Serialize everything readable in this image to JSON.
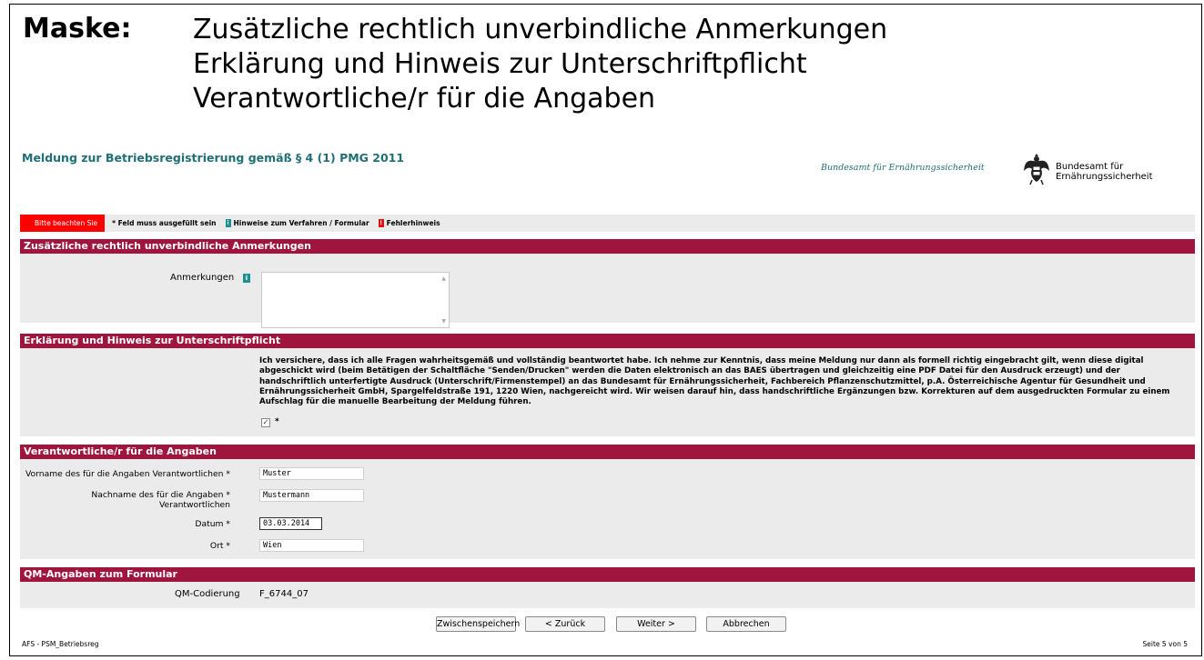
{
  "header": {
    "maske_label": "Maske:",
    "maske_lines": [
      "Zusätzliche rechtlich unverbindliche Anmerkungen",
      "Erklärung und Hinweis zur Unterschriftpflicht",
      "Verantwortliche/r für die Angaben"
    ]
  },
  "app": {
    "title": "Meldung zur Betriebsregistrierung gemäß § 4 (1) PMG 2011",
    "agency_script": "Bundesamt für Ernährungssicherheit",
    "agency_name": "Bundesamt für Ernährungssicherheit"
  },
  "legend": {
    "warning": "Bitte beachten Sie",
    "required": "* Feld muss ausgefüllt sein",
    "info": "Hinweise zum Verfahren / Formular",
    "error": "Fehlerhinweis",
    "info_icon_char": "i",
    "error_icon_char": "!"
  },
  "sections": {
    "anmerkungen": {
      "title": "Zusätzliche rechtlich unverbindliche Anmerkungen",
      "label": "Anmerkungen",
      "value": ""
    },
    "erklaerung": {
      "title": "Erklärung und Hinweis zur Unterschriftpflicht",
      "text": "Ich versichere, dass ich alle Fragen wahrheitsgemäß und vollständig beantwortet habe. Ich nehme zur Kenntnis, dass meine Meldung nur dann als formell richtig eingebracht gilt, wenn diese digital abgeschickt wird (beim Betätigen der Schaltfläche \"Senden/Drucken\" werden die Daten elektronisch an das BAES übertragen und gleichzeitig eine PDF Datei für den Ausdruck erzeugt) und der handschriftlich unterfertigte Ausdruck (Unterschrift/Firmenstempel) an das Bundesamt für Ernährungssicherheit, Fachbereich Pflanzenschutzmittel, p.A. Österreichische Agentur für Gesundheit und Ernährungssicherheit GmbH, Spargelfeldstraße 191, 1220 Wien, nachgereicht wird. Wir weisen darauf hin, dass handschriftliche Ergänzungen bzw. Korrekturen auf dem ausgedruckten Formular zu einem Aufschlag für die manuelle Bearbeitung der Meldung führen.",
      "checkbox_mark": "✓",
      "required_mark": "*"
    },
    "verantwortlich": {
      "title": "Verantwortliche/r für die Angaben",
      "vorname_label": "Vorname des für die Angaben Verantwortlichen *",
      "vorname_value": "Muster",
      "nachname_label_1": "Nachname des für die Angaben *",
      "nachname_label_2": "Verantwortlichen",
      "nachname_value": "Mustermann",
      "datum_label": "Datum *",
      "datum_value": "03.03.2014",
      "ort_label": "Ort *",
      "ort_value": "Wien"
    },
    "qm": {
      "title": "QM-Angaben zum Formular",
      "label": "QM-Codierung",
      "value": "F_6744_07"
    }
  },
  "buttons": {
    "save": "Zwischenspeichern",
    "back": "< Zurück",
    "next": "Weiter >",
    "cancel": "Abbrechen"
  },
  "footer": {
    "left": "AFS - PSM_Betriebsreg",
    "right": "Seite 5 von 5"
  }
}
